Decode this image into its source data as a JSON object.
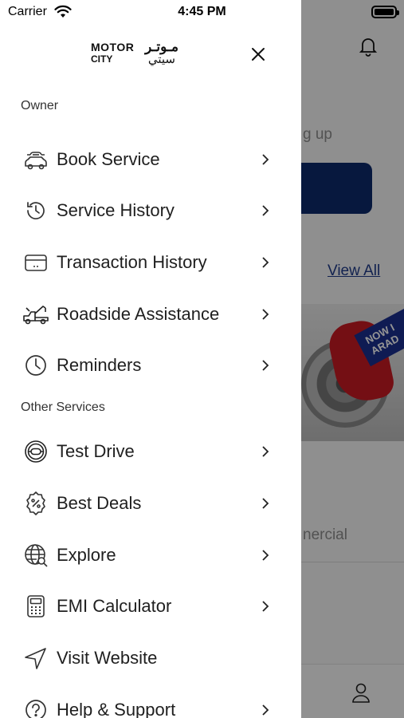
{
  "status_bar": {
    "carrier": "Carrier",
    "time": "4:45 PM"
  },
  "background": {
    "partial_text_1": "g up",
    "view_all": "View All",
    "banner_tag_line1": "NOW I",
    "banner_tag_line2": "ARAD",
    "partial_text_2": "nercial"
  },
  "drawer": {
    "logo": {
      "en_line1": "MOTOR",
      "en_line2": "CITY",
      "ar_line1": "مـوتـر",
      "ar_line2": "سيتي"
    },
    "sections": {
      "owner": "Owner",
      "other": "Other Services"
    },
    "owner_items": [
      {
        "label": "Book Service",
        "icon": "car-wrench-icon"
      },
      {
        "label": "Service History",
        "icon": "history-icon"
      },
      {
        "label": "Transaction History",
        "icon": "card-icon"
      },
      {
        "label": "Roadside Assistance",
        "icon": "tow-truck-icon"
      },
      {
        "label": "Reminders",
        "icon": "clock-icon"
      }
    ],
    "other_items": [
      {
        "label": "Test Drive",
        "icon": "steering-wheel-icon"
      },
      {
        "label": "Best Deals",
        "icon": "discount-badge-icon"
      },
      {
        "label": "Explore",
        "icon": "globe-search-icon"
      },
      {
        "label": "EMI Calculator",
        "icon": "calculator-icon"
      },
      {
        "label": "Visit Website",
        "icon": "navigation-arrow-icon"
      },
      {
        "label": "Help & Support",
        "icon": "help-icon"
      }
    ]
  }
}
